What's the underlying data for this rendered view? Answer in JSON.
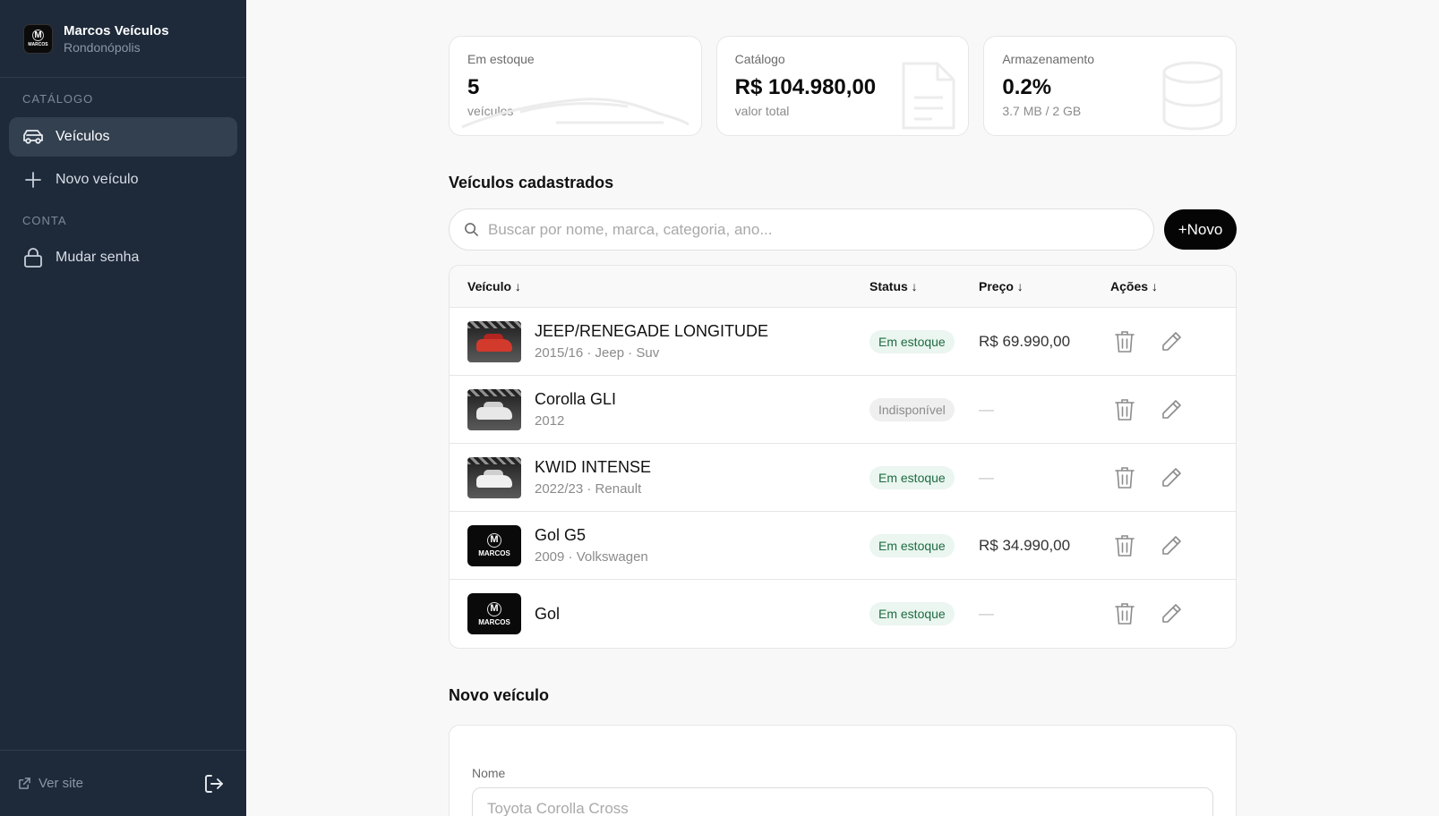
{
  "brand": {
    "name": "Marcos Veículos",
    "city": "Rondonópolis",
    "logo_letter": "M",
    "logo_text": "MARCOS"
  },
  "sidebar": {
    "catalog_label": "CATÁLOGO",
    "account_label": "CONTA",
    "items": [
      {
        "label": "Veículos",
        "icon": "car-icon",
        "active": true
      },
      {
        "label": "Novo veículo",
        "icon": "plus-icon",
        "active": false
      },
      {
        "label": "Mudar senha",
        "icon": "lock-icon",
        "active": false
      }
    ],
    "footer": {
      "site_label": "Ver site"
    }
  },
  "stats": [
    {
      "label": "Em estoque",
      "value": "5",
      "sub": "veículos"
    },
    {
      "label": "Catálogo",
      "value": "R$ 104.980,00",
      "sub": "valor total"
    },
    {
      "label": "Armazenamento",
      "value": "0.2%",
      "sub": "3.7 MB / 2 GB"
    }
  ],
  "list": {
    "title": "Veículos cadastrados",
    "search_placeholder": "Buscar por nome, marca, categoria, ano...",
    "new_button": "+Novo",
    "columns": {
      "vehicle": "Veículo ↓",
      "status": "Status ↓",
      "price": "Preço ↓",
      "actions": "Ações ↓"
    },
    "rows": [
      {
        "name": "JEEP/RENEGADE LONGITUDE",
        "meta": "2015/16 · Jeep · Suv",
        "status": "Em estoque",
        "price": "R$ 69.990,00",
        "thumb": "photo-red"
      },
      {
        "name": "Corolla GLI",
        "meta": "2012",
        "status": "Indisponível",
        "price": "—",
        "thumb": "photo-white"
      },
      {
        "name": "KWID INTENSE",
        "meta": "2022/23 · Renault",
        "status": "Em estoque",
        "price": "—",
        "thumb": "photo-white"
      },
      {
        "name": "Gol G5",
        "meta": "2009 · Volkswagen",
        "status": "Em estoque",
        "price": "R$ 34.990,00",
        "thumb": "logo"
      },
      {
        "name": "Gol",
        "meta": "",
        "status": "Em estoque",
        "price": "—",
        "thumb": "logo"
      }
    ]
  },
  "form": {
    "title": "Novo veículo",
    "name_label": "Nome",
    "name_placeholder": "Toyota Corolla Cross"
  },
  "colors": {
    "sidebar_bg": "#1e2a3a",
    "accent": "#050505",
    "status_ok_bg": "#eaf6ef",
    "status_ok_text": "#1f6b43"
  }
}
